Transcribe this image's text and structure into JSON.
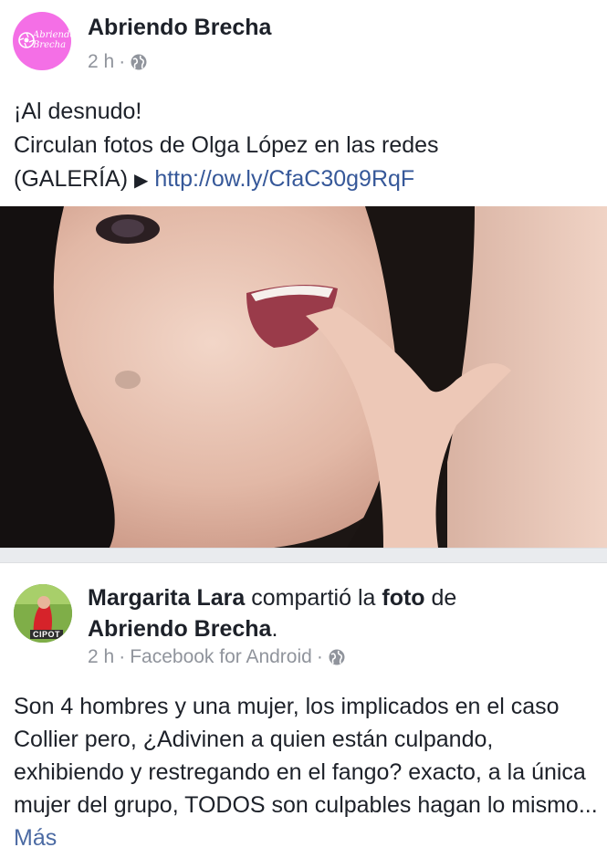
{
  "post1": {
    "page_name": "Abriendo Brecha",
    "avatar_logo_text": "Abriendo\nBrecha",
    "time": "2 h",
    "separator": "·",
    "line1": "¡Al desnudo!",
    "line2": "Circulan fotos de Olga López en las redes",
    "line3_prefix": "(GALERÍA)",
    "arrow": "▶",
    "link": "http://ow.ly/CfaC30g9RqF"
  },
  "post2": {
    "user_name": "Margarita Lara",
    "shared_text": "compartió la",
    "photo_word": "foto",
    "de": "de",
    "source_page": "Abriendo Brecha",
    "period": ".",
    "avatar_badge": "CIPOT",
    "time": "2 h",
    "separator": "·",
    "via": "Facebook for Android",
    "separator2": "·",
    "body": "Son 4 hombres y una mujer, los implicados en el caso Collier pero, ¿Adivinen a quien están culpando, exhibiendo y restregando en el fango? exacto, a la única mujer del grupo, TODOS son culpables hagan lo mismo...",
    "more": "Más"
  },
  "colors": {
    "brand_pink": "#f46fe6",
    "link_blue": "#365899",
    "meta_gray": "#90949c",
    "text": "#1d2129"
  },
  "icons": [
    "globe-icon",
    "globe-icon",
    "pink-logo-icon"
  ]
}
